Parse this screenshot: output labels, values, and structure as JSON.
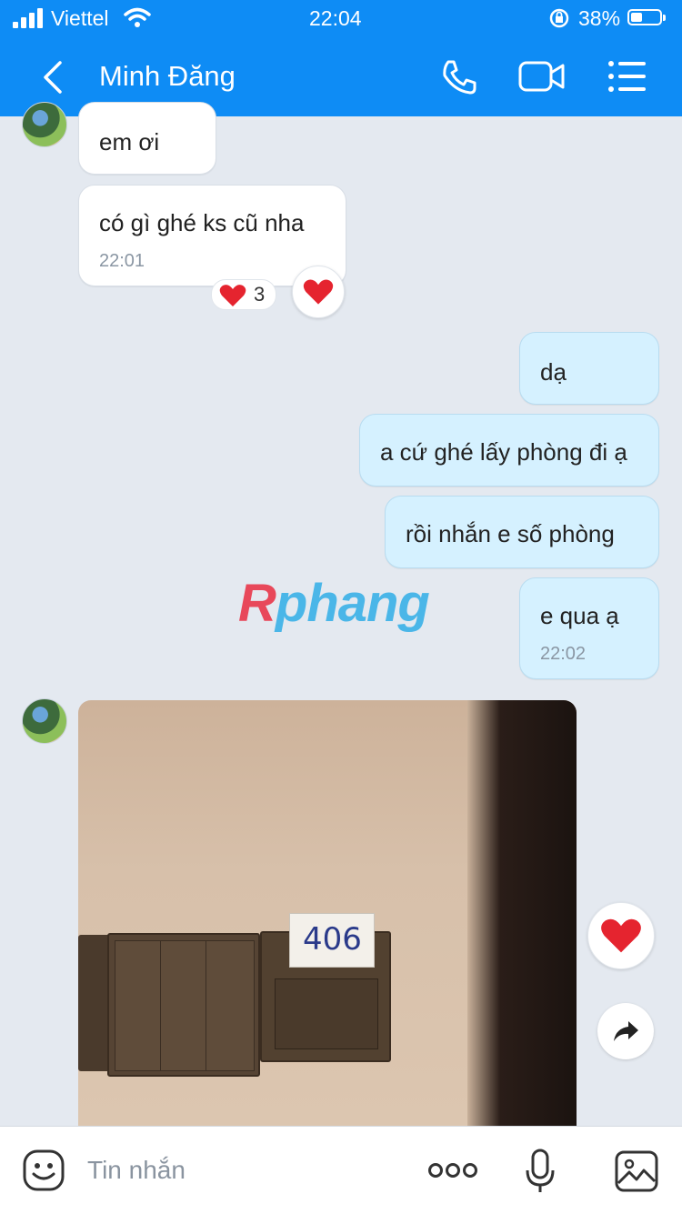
{
  "status": {
    "carrier": "Viettel",
    "time": "22:04",
    "battery": "38%"
  },
  "header": {
    "title": "Minh Đăng"
  },
  "messages": {
    "m1": "em ơi",
    "m2": "có gì ghé ks cũ nha",
    "m2_time": "22:01",
    "m2_reaction_count": "3",
    "m3": "dạ",
    "m4": "a cứ ghé lấy phòng đi ạ",
    "m5": "rồi nhắn e số phòng",
    "m6": "e qua ạ",
    "m6_time": "22:02",
    "photo_card_number": "406"
  },
  "watermark": {
    "first": "R",
    "rest": "phang"
  },
  "input": {
    "placeholder": "Tin nhắn"
  }
}
